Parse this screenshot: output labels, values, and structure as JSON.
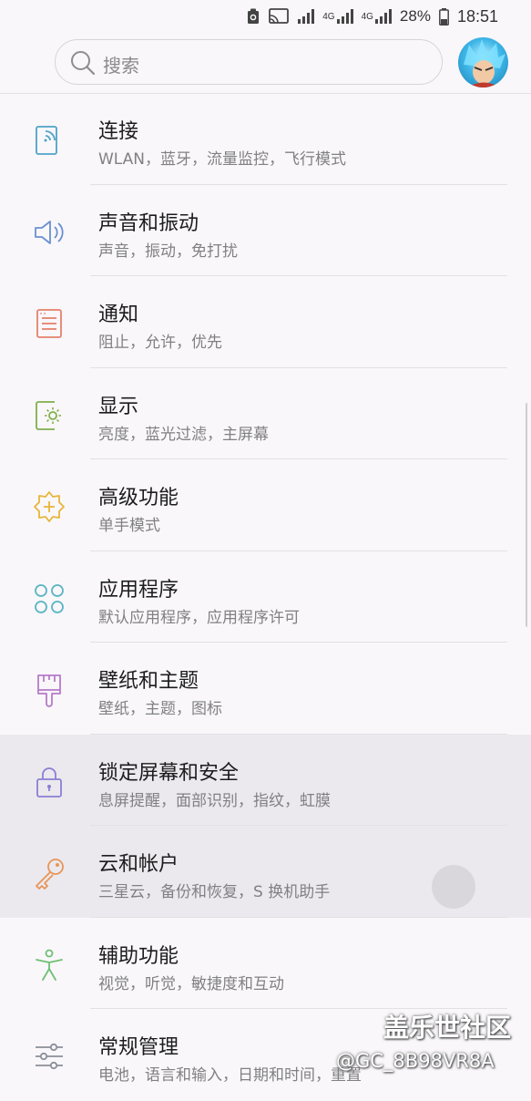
{
  "status_bar": {
    "network_1": "4G",
    "network_2": "4G",
    "battery": "28%",
    "time": "18:51"
  },
  "search": {
    "placeholder": "搜索"
  },
  "settings": [
    {
      "title": "连接",
      "subtitle": "WLAN，蓝牙，流量监控，飞行模式",
      "icon": "connection-icon",
      "color": "#4fa3c7"
    },
    {
      "title": "声音和振动",
      "subtitle": "声音，振动，免打扰",
      "icon": "volume-icon",
      "color": "#6a8fd2"
    },
    {
      "title": "通知",
      "subtitle": "阻止，允许，优先",
      "icon": "notification-icon",
      "color": "#e4826b"
    },
    {
      "title": "显示",
      "subtitle": "亮度，蓝光过滤，主屏幕",
      "icon": "display-icon",
      "color": "#7fb04c"
    },
    {
      "title": "高级功能",
      "subtitle": "单手模式",
      "icon": "advanced-features-icon",
      "color": "#e8b53a"
    },
    {
      "title": "应用程序",
      "subtitle": "默认应用程序，应用程序许可",
      "icon": "apps-icon",
      "color": "#5ab4c4"
    },
    {
      "title": "壁纸和主题",
      "subtitle": "壁纸，主题，图标",
      "icon": "paintbrush-icon",
      "color": "#b57bc9"
    },
    {
      "title": "锁定屏幕和安全",
      "subtitle": "息屏提醒，面部识别，指纹，虹膜",
      "icon": "lock-icon",
      "color": "#8a7fd6"
    },
    {
      "title": "云和帐户",
      "subtitle": "三星云，备份和恢复，S 换机助手",
      "icon": "key-icon",
      "color": "#e8955a"
    },
    {
      "title": "辅助功能",
      "subtitle": "视觉，听觉，敏捷度和互动",
      "icon": "accessibility-icon",
      "color": "#6fbf73"
    },
    {
      "title": "常规管理",
      "subtitle": "电池，语言和输入，日期和时间，重置",
      "icon": "sliders-icon",
      "color": "#8a8f9a"
    }
  ],
  "watermark": {
    "brand": "盖乐世社区",
    "user": "@GC_8B98VR8A"
  }
}
